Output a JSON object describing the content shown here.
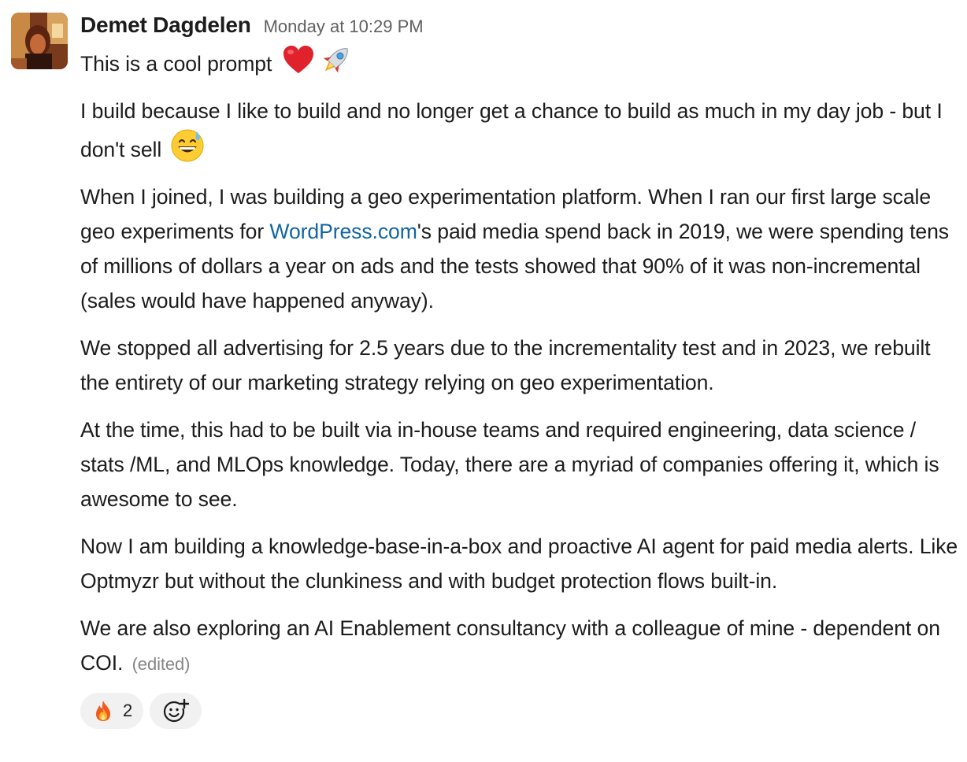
{
  "message": {
    "author": "Demet Dagdelen",
    "timestamp": "Monday at 10:29 PM",
    "paragraphs": {
      "p1": "This is a cool prompt",
      "p2": "I build because I like to build and no longer get a chance to build as much in my day job - but I don't sell",
      "p3_before_link": "When I joined, I was building a geo experimentation platform. When I ran our first large scale geo experiments for ",
      "p3_link": "WordPress.com",
      "p3_after_link": "'s paid media spend back in 2019, we were spending tens of millions of dollars a year on ads and the tests showed that 90% of it was non-incremental (sales would have happened anyway).",
      "p4": "We stopped all advertising for 2.5 years due to the incrementality test and in 2023, we rebuilt the entirety of our marketing strategy relying on geo experimentation.",
      "p5": "At the time, this had to be built via in-house teams and required engineering, data science / stats /ML, and MLOps knowledge. Today, there are a myriad of companies offering it, which is awesome to see.",
      "p6": "Now I am building a knowledge-base-in-a-box and proactive AI agent for paid media alerts. Like Optmyzr but without the clunkiness and with budget protection flows built-in.",
      "p7": "We are also exploring an AI Enablement consultancy with a colleague of mine - dependent on COI."
    },
    "edited_label": "(edited)",
    "inline_emojis": [
      "red-heart",
      "rocket",
      "grinning-face-with-sweat"
    ]
  },
  "reactions": [
    {
      "emoji": "fire",
      "count": "2"
    }
  ],
  "add_reaction_icon": "add-reaction-icon",
  "colors": {
    "text": "#1d1c1d",
    "timestamp": "#616061",
    "link": "#1264a3",
    "edited": "#868686",
    "reaction_bg": "#f1f1f1"
  }
}
